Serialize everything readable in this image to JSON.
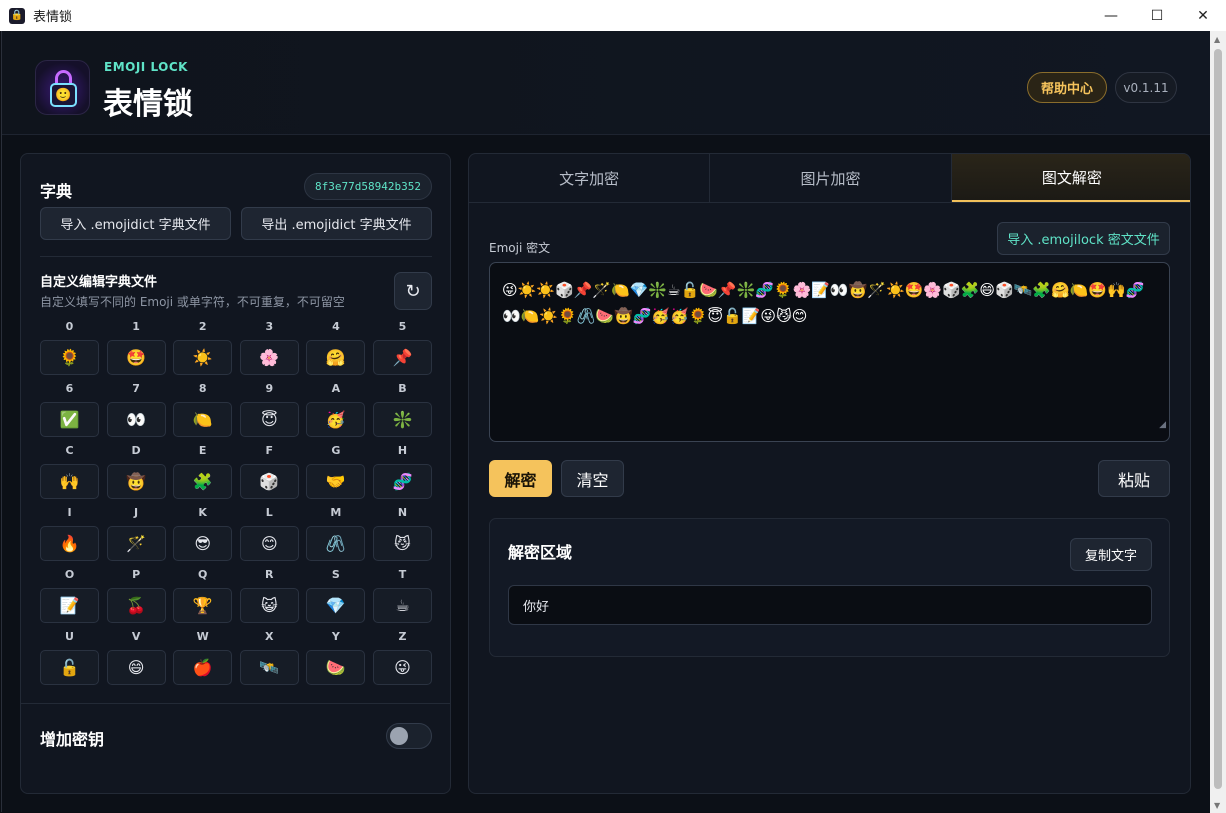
{
  "window": {
    "title": "表情锁"
  },
  "header": {
    "brand_sub": "EMOJI LOCK",
    "brand_title": "表情锁",
    "help_label": "帮助中心",
    "version": "v0.1.11"
  },
  "dictionary": {
    "title": "字典",
    "hash": "8f3e77d58942b352",
    "import_label": "导入 .emojidict 字典文件",
    "export_label": "导出 .emojidict 字典文件",
    "custom_title": "自定义编辑字典文件",
    "custom_desc": "自定义填写不同的 Emoji 或单字符，不可重复，不可留空",
    "cells": [
      {
        "key": "0",
        "emoji": "🌻"
      },
      {
        "key": "1",
        "emoji": "🤩"
      },
      {
        "key": "2",
        "emoji": "☀️"
      },
      {
        "key": "3",
        "emoji": "🌸"
      },
      {
        "key": "4",
        "emoji": "🤗"
      },
      {
        "key": "5",
        "emoji": "📌"
      },
      {
        "key": "6",
        "emoji": "✅"
      },
      {
        "key": "7",
        "emoji": "👀"
      },
      {
        "key": "8",
        "emoji": "🍋"
      },
      {
        "key": "9",
        "emoji": "😇"
      },
      {
        "key": "A",
        "emoji": "🥳"
      },
      {
        "key": "B",
        "emoji": "❇️"
      },
      {
        "key": "C",
        "emoji": "🙌"
      },
      {
        "key": "D",
        "emoji": "🤠"
      },
      {
        "key": "E",
        "emoji": "🧩"
      },
      {
        "key": "F",
        "emoji": "🎲"
      },
      {
        "key": "G",
        "emoji": "🤝"
      },
      {
        "key": "H",
        "emoji": "🧬"
      },
      {
        "key": "I",
        "emoji": "🔥"
      },
      {
        "key": "J",
        "emoji": "🪄"
      },
      {
        "key": "K",
        "emoji": "😎"
      },
      {
        "key": "L",
        "emoji": "😊"
      },
      {
        "key": "M",
        "emoji": "🖇️"
      },
      {
        "key": "N",
        "emoji": "😼"
      },
      {
        "key": "O",
        "emoji": "📝"
      },
      {
        "key": "P",
        "emoji": "🍒"
      },
      {
        "key": "Q",
        "emoji": "🏆"
      },
      {
        "key": "R",
        "emoji": "😺"
      },
      {
        "key": "S",
        "emoji": "💎"
      },
      {
        "key": "T",
        "emoji": "☕"
      },
      {
        "key": "U",
        "emoji": "🔓"
      },
      {
        "key": "V",
        "emoji": "😄"
      },
      {
        "key": "W",
        "emoji": "🍎"
      },
      {
        "key": "X",
        "emoji": "🛰️"
      },
      {
        "key": "Y",
        "emoji": "🍉"
      },
      {
        "key": "Z",
        "emoji": "😜"
      }
    ],
    "add_key_label": "增加密钥"
  },
  "tabs": [
    {
      "label": "文字加密"
    },
    {
      "label": "图片加密"
    },
    {
      "label": "图文解密"
    }
  ],
  "decrypt": {
    "cipher_label": "Emoji 密文",
    "import_label": "导入 .emojilock 密文文件",
    "cipher_text": "😜☀️☀️🎲📌🪄🍋💎❇️☕🔓🍉📌❇️🧬🌻🌸📝👀🤠🪄☀️🤩🌸🎲🧩😄🎲🛰️🧩🤗🍋🤩🙌🧬👀🍋☀️🌻🖇️🍉🤠🧬🥳🥳🌻😇🔓📝😜😼😊",
    "decrypt_label": "解密",
    "clear_label": "清空",
    "paste_label": "粘贴",
    "result_title": "解密区域",
    "copy_label": "复制文字",
    "result_text": "你好"
  }
}
